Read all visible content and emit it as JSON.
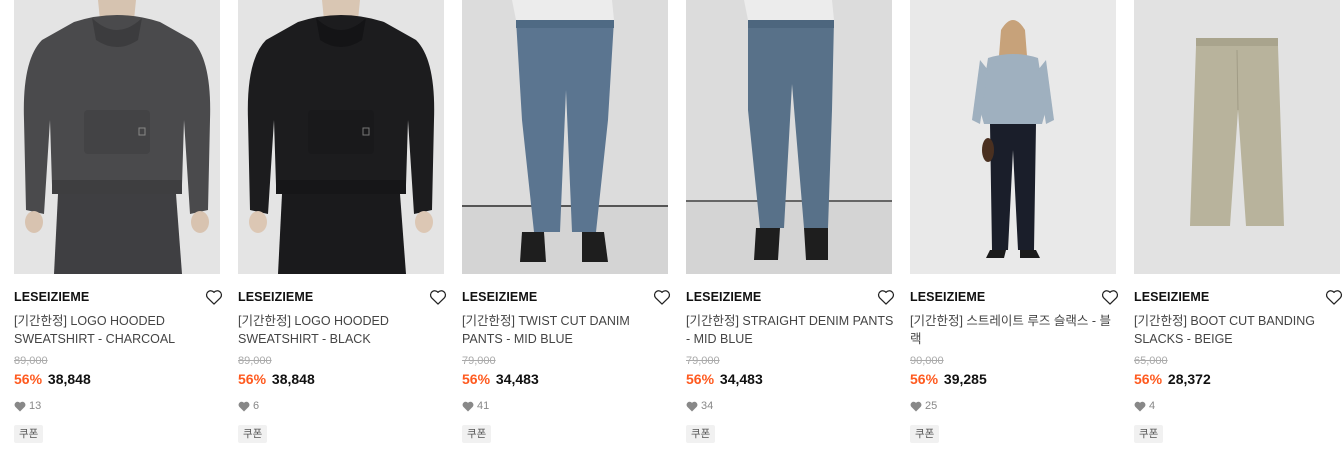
{
  "products": [
    {
      "brand": "LESEIZIEME",
      "title": "[기간한정] LOGO HOODED SWEATSHIRT - CHARCOAL",
      "original_price": "89,000",
      "discount": "56%",
      "price": "38,848",
      "likes": "13",
      "badge": "쿠폰",
      "image": "charcoal-hoodie",
      "bg_color": "#e4e4e4",
      "item_color": "#4a4a4c"
    },
    {
      "brand": "LESEIZIEME",
      "title": "[기간한정] LOGO HOODED SWEATSHIRT - BLACK",
      "original_price": "89,000",
      "discount": "56%",
      "price": "38,848",
      "likes": "6",
      "badge": "쿠폰",
      "image": "black-hoodie",
      "bg_color": "#e4e4e4",
      "item_color": "#1c1c1e"
    },
    {
      "brand": "LESEIZIEME",
      "title": "[기간한정] TWIST CUT DANIM PANTS - MID BLUE",
      "original_price": "79,000",
      "discount": "56%",
      "price": "34,483",
      "likes": "41",
      "badge": "쿠폰",
      "image": "denim-pants",
      "bg_color": "#dcdcdc",
      "item_color": "#5b7590"
    },
    {
      "brand": "LESEIZIEME",
      "title": "[기간한정] STRAIGHT DENIM PANTS - MID BLUE",
      "original_price": "79,000",
      "discount": "56%",
      "price": "34,483",
      "likes": "34",
      "badge": "쿠폰",
      "image": "denim-pants",
      "bg_color": "#dcdcdc",
      "item_color": "#587189"
    },
    {
      "brand": "LESEIZIEME",
      "title": "[기간한정] 스트레이트 루즈 슬랙스 - 블랙",
      "original_price": "90,000",
      "discount": "56%",
      "price": "39,285",
      "likes": "25",
      "badge": "쿠폰",
      "image": "model-cardigan-slacks",
      "bg_color": "#e9e9e9",
      "item_color": "#1a1e2a"
    },
    {
      "brand": "LESEIZIEME",
      "title": "[기간한정] BOOT CUT BANDING SLACKS - BEIGE",
      "original_price": "65,000",
      "discount": "56%",
      "price": "28,372",
      "likes": "4",
      "badge": "쿠폰",
      "image": "beige-slacks",
      "bg_color": "#e2e2e2",
      "item_color": "#b8b39c"
    }
  ],
  "colors": {
    "discount": "#ff5a1f",
    "brand": "#111111",
    "muted": "#888888"
  }
}
